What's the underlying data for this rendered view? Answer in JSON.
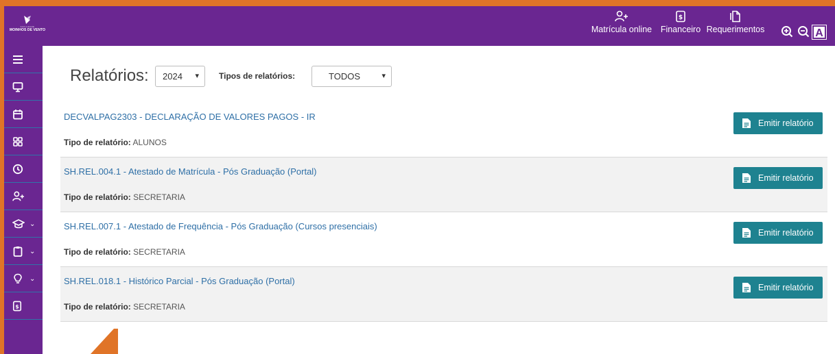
{
  "topbar": {
    "logo": {
      "small_text": "FACULDADE",
      "brand": "MOINHOS DE VENTO"
    },
    "nav": [
      {
        "label": "Matrícula online",
        "icon": "user-plus-icon"
      },
      {
        "label": "Financeiro",
        "icon": "invoice-icon"
      },
      {
        "label": "Requerimentos",
        "icon": "documents-icon"
      }
    ],
    "font_button": "A"
  },
  "sidebar": {
    "items": [
      {
        "icon": "menu-icon"
      },
      {
        "icon": "monitor-icon"
      },
      {
        "icon": "calendar-icon"
      },
      {
        "icon": "grid-icon"
      },
      {
        "icon": "clock-icon"
      },
      {
        "icon": "user-plus-icon"
      },
      {
        "icon": "graduation-cap-icon",
        "chevron": "⌄"
      },
      {
        "icon": "clipboard-icon",
        "chevron": "⌄"
      },
      {
        "icon": "lightbulb-icon",
        "chevron": "⌄"
      },
      {
        "icon": "invoice-icon"
      }
    ]
  },
  "main": {
    "title": "Relatórios:",
    "year": "2024",
    "types_label": "Tipos de relatórios:",
    "types_value": "TODOS",
    "kind_label": "Tipo de relatório:",
    "emit_label": "Emitir relatório",
    "reports": [
      {
        "name": "DECVALPAG2303 - DECLARAÇÃO DE VALORES PAGOS - IR",
        "kind": "ALUNOS"
      },
      {
        "name": "SH.REL.004.1 - Atestado de Matrícula - Pós Graduação (Portal)",
        "kind": "SECRETARIA"
      },
      {
        "name": "SH.REL.007.1 - Atestado de Frequência - Pós Graduação (Cursos presenciais)",
        "kind": "SECRETARIA"
      },
      {
        "name": "SH.REL.018.1 - Histórico Parcial - Pós Graduação (Portal)",
        "kind": "SECRETARIA"
      }
    ]
  },
  "colors": {
    "purple": "#6a2691",
    "teal_button": "#1e8290",
    "link": "#2e6fa6",
    "orange_frame": "#e07427"
  }
}
